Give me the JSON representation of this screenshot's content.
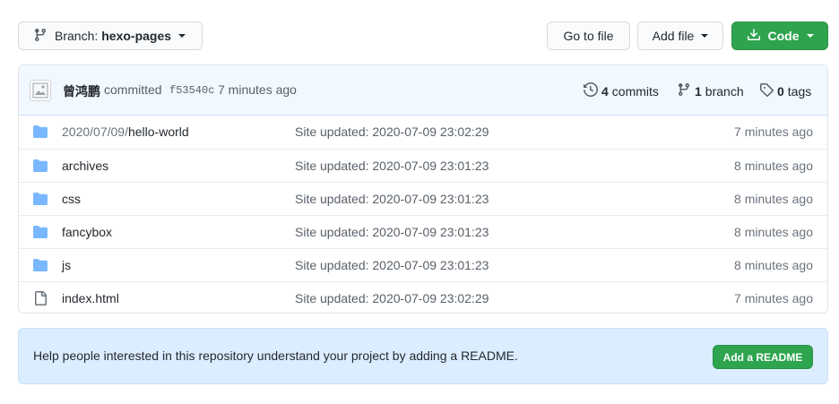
{
  "toolbar": {
    "branch_label": "Branch:",
    "branch_name": "hexo-pages",
    "goto_file": "Go to file",
    "add_file": "Add file",
    "code": "Code"
  },
  "commit": {
    "author": "曾鸿鹏",
    "verb": "committed",
    "sha": "f53540c",
    "time": "7 minutes ago",
    "commits_count": "4",
    "commits_label": "commits",
    "branch_count": "1",
    "branch_label": "branch",
    "tags_count": "0",
    "tags_label": "tags"
  },
  "files": [
    {
      "prefix": "2020/07/09/",
      "name": "hello-world",
      "type": "folder",
      "message": "Site updated: 2020-07-09 23:02:29",
      "age": "7 minutes ago"
    },
    {
      "prefix": "",
      "name": "archives",
      "type": "folder",
      "message": "Site updated: 2020-07-09 23:01:23",
      "age": "8 minutes ago"
    },
    {
      "prefix": "",
      "name": "css",
      "type": "folder",
      "message": "Site updated: 2020-07-09 23:01:23",
      "age": "8 minutes ago"
    },
    {
      "prefix": "",
      "name": "fancybox",
      "type": "folder",
      "message": "Site updated: 2020-07-09 23:01:23",
      "age": "8 minutes ago"
    },
    {
      "prefix": "",
      "name": "js",
      "type": "folder",
      "message": "Site updated: 2020-07-09 23:01:23",
      "age": "8 minutes ago"
    },
    {
      "prefix": "",
      "name": "index.html",
      "type": "file",
      "message": "Site updated: 2020-07-09 23:02:29",
      "age": "7 minutes ago"
    }
  ],
  "readme": {
    "text": "Help people interested in this repository understand your project by adding a README.",
    "button": "Add a README"
  },
  "colors": {
    "folder": "#79b8ff",
    "primary_button": "#2ea44f",
    "header_bg": "#f1f8ff",
    "readme_bg": "#dbedff"
  }
}
